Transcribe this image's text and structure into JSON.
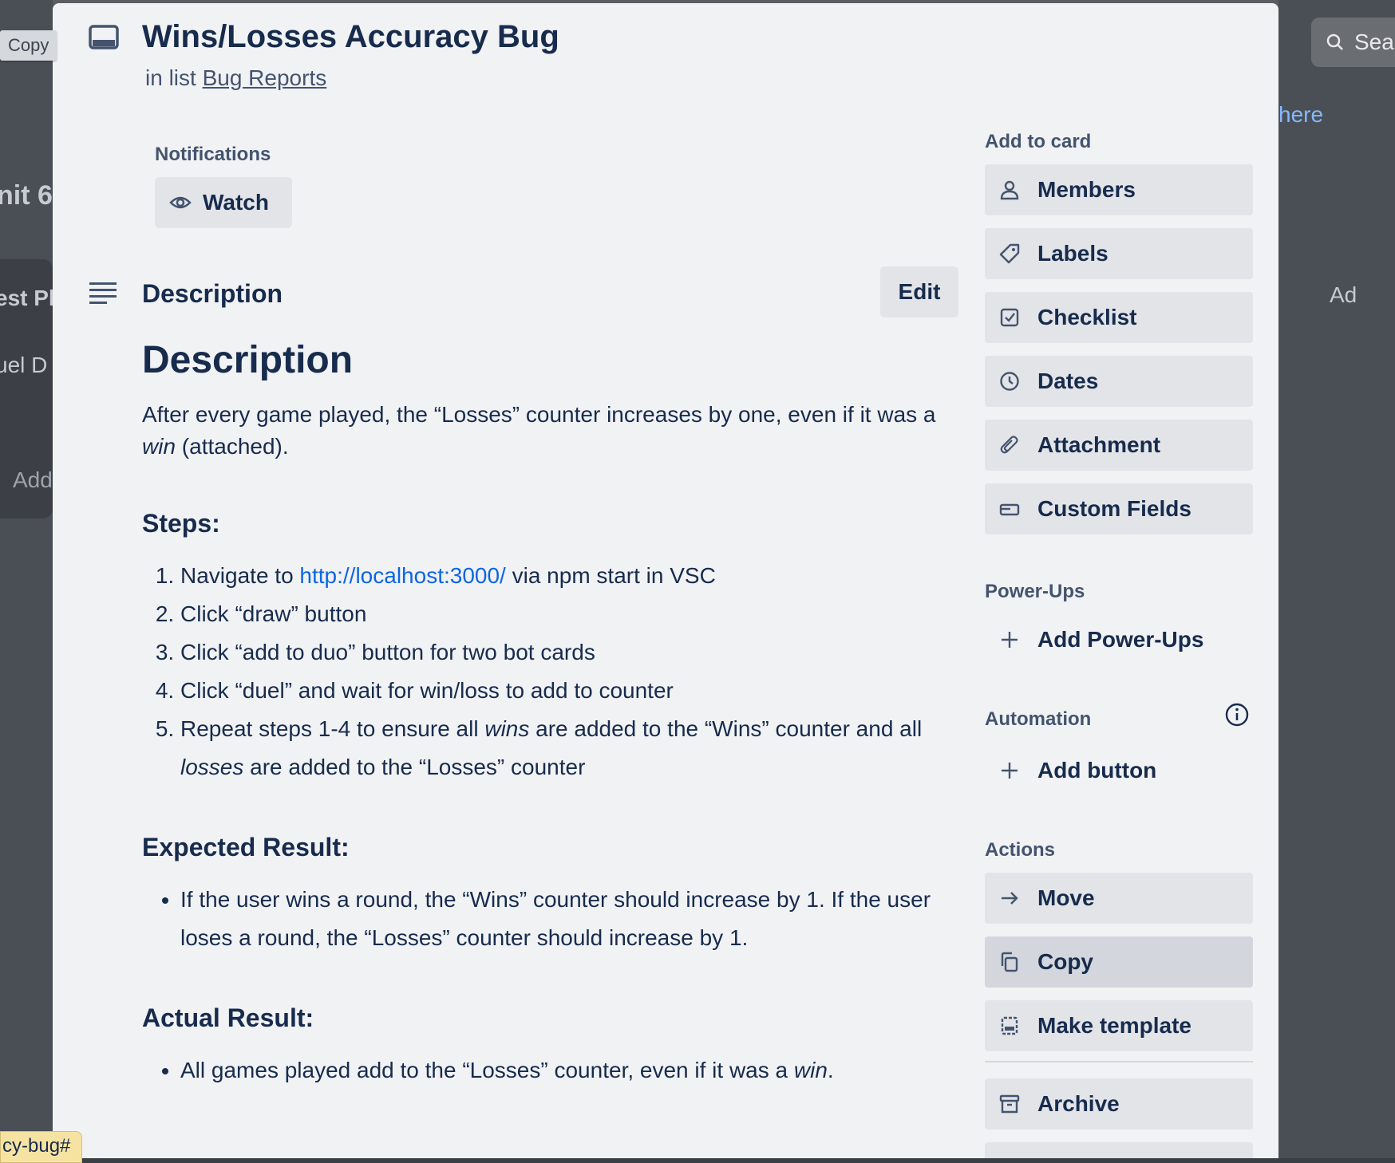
{
  "background": {
    "left_texts": [
      "nit 6",
      "est Pl",
      "uel D",
      "Add"
    ],
    "right_texts": [
      "here",
      "Ad"
    ],
    "search_placeholder": "Sea"
  },
  "tooltip": "Copy",
  "status_url": "cy-bug#",
  "card": {
    "title": "Wins/Losses Accuracy Bug",
    "in_list_prefix": "in list",
    "list_name": "Bug Reports"
  },
  "notifications": {
    "label": "Notifications",
    "watch_label": "Watch"
  },
  "description": {
    "section_label": "Description",
    "edit_label": "Edit",
    "heading": "Description",
    "intro_1": "After every game played, the “Losses” counter increases by one, even if it was a ",
    "intro_em": "win",
    "intro_2": " (attached).",
    "steps_heading": "Steps:",
    "step1_pre": "Navigate to ",
    "step1_link": "http://localhost:3000/",
    "step1_post": " via npm start in VSC",
    "step2": "Click “draw” button",
    "step3": "Click “add to duo” button for two bot cards",
    "step4": "Click “duel” and wait for win/loss to add to counter",
    "step5_a": "Repeat steps 1-4 to ensure all ",
    "step5_em1": "wins",
    "step5_b": " are added to the “Wins” counter and all ",
    "step5_em2": "losses",
    "step5_c": " are added to the “Losses” counter",
    "expected_heading": "Expected Result:",
    "expected_item": "If the user wins a round, the “Wins” counter should increase by 1. If the user loses a round, the “Losses” counter should increase by 1.",
    "actual_heading": "Actual Result:",
    "actual_pre": "All games played add to the “Losses” counter, even if it was a ",
    "actual_em": "win",
    "actual_post": "."
  },
  "sidebar": {
    "add_to_card_label": "Add to card",
    "add_to_card": [
      {
        "label": "Members",
        "icon": "person-icon"
      },
      {
        "label": "Labels",
        "icon": "tag-icon"
      },
      {
        "label": "Checklist",
        "icon": "checkbox-icon"
      },
      {
        "label": "Dates",
        "icon": "clock-icon"
      },
      {
        "label": "Attachment",
        "icon": "paperclip-icon"
      },
      {
        "label": "Custom Fields",
        "icon": "custom-fields-icon"
      }
    ],
    "powerups_label": "Power-Ups",
    "add_powerups": "Add Power-Ups",
    "automation_label": "Automation",
    "add_button": "Add button",
    "actions_label": "Actions",
    "actions": [
      {
        "label": "Move",
        "icon": "arrow-right-icon"
      },
      {
        "label": "Copy",
        "icon": "copy-icon"
      },
      {
        "label": "Make template",
        "icon": "template-icon"
      },
      {
        "label": "Archive",
        "icon": "archive-icon"
      }
    ]
  }
}
